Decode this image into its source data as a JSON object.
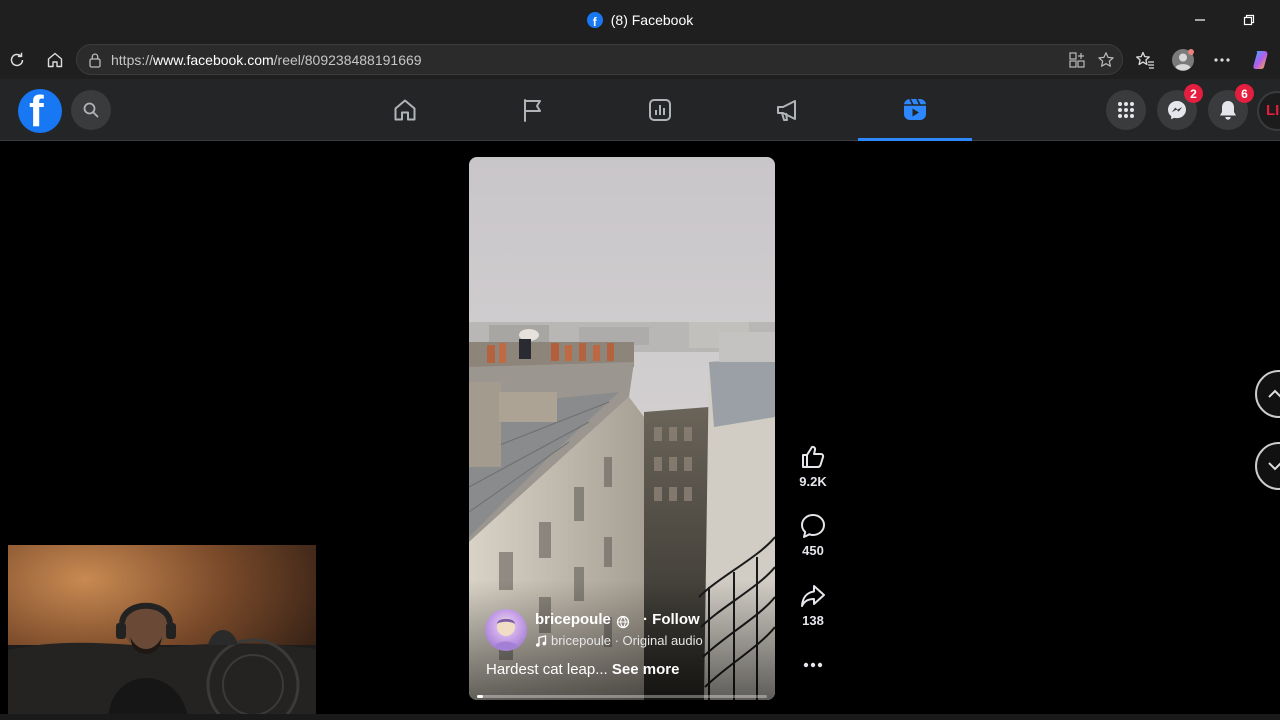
{
  "browser": {
    "window_title": "(8) Facebook",
    "url_prefix": "https://",
    "url_domain": "www.facebook.com",
    "url_path": "/reel/809238488191669"
  },
  "header": {
    "logo": "f",
    "tabs": [
      {
        "name": "home",
        "icon": "home-icon"
      },
      {
        "name": "pages",
        "icon": "flag-icon"
      },
      {
        "name": "dashboard",
        "icon": "chart-icon"
      },
      {
        "name": "ads",
        "icon": "megaphone-icon"
      },
      {
        "name": "reels",
        "icon": "reels-icon",
        "active": true
      }
    ],
    "messenger_badge": "2",
    "notifications_badge": "6",
    "profile_initials": "LI"
  },
  "reel": {
    "author": "bricepoule",
    "follow_label": "· Follow",
    "audio_label": "bricepoule · Original audio",
    "caption": "Hardest cat leap...",
    "see_more": "See more",
    "progress": 0.02
  },
  "actions": {
    "likes": "9.2K",
    "comments": "450",
    "shares": "138"
  },
  "colors": {
    "facebook_blue": "#1877f2",
    "active_tab": "#2d88ff",
    "badge_red": "#e41e3f"
  }
}
